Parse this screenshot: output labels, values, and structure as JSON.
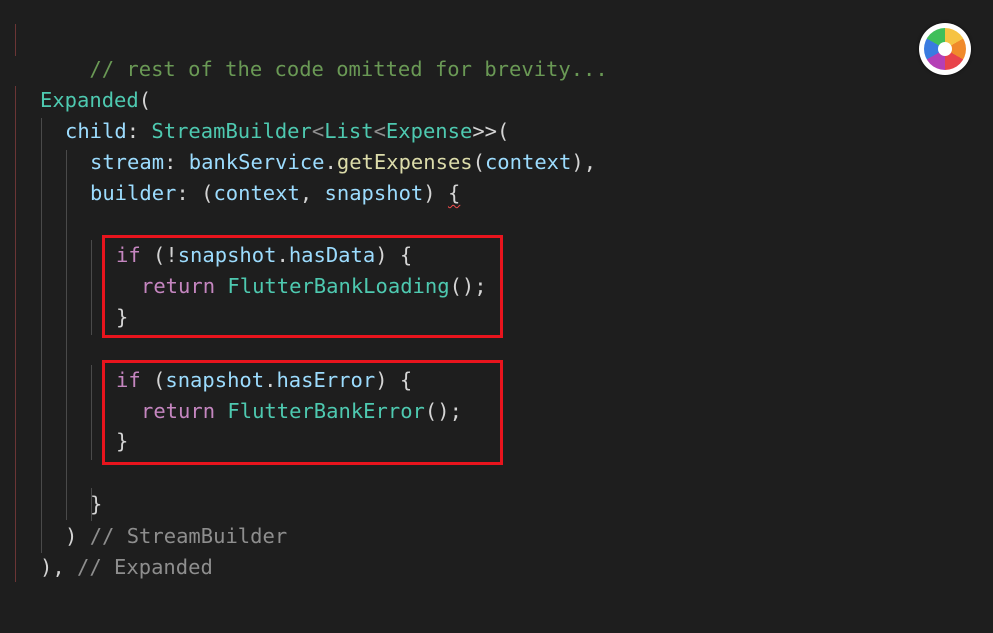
{
  "code": {
    "l1_comment": "// rest of the code omitted for brevity...",
    "l2_expanded": "Expanded",
    "l2_paren": "(",
    "l3_child": "child",
    "l3_colon": ": ",
    "l3_streambuilder": "StreamBuilder",
    "l3_lt1": "<",
    "l3_list": "List",
    "l3_lt2": "<",
    "l3_expense": "Expense",
    "l3_gt": ">>(",
    "l4_stream": "stream",
    "l4_colon": ": ",
    "l4_bankservice": "bankService",
    "l4_dot": ".",
    "l4_getexpenses": "getExpenses",
    "l4_open": "(",
    "l4_context": "context",
    "l4_close": "),",
    "l5_builder": "builder",
    "l5_colon": ": (",
    "l5_context": "context",
    "l5_comma": ", ",
    "l5_snapshot": "snapshot",
    "l5_close": ") ",
    "l5_brace": "{",
    "l6_if": "if",
    "l6_open": " (!",
    "l6_snapshot": "snapshot",
    "l6_dot": ".",
    "l6_hasdata": "hasData",
    "l6_close": ") {",
    "l7_return": "return",
    "l7_space": " ",
    "l7_loading": "FlutterBankLoading",
    "l7_end": "();",
    "l8_brace": "}",
    "l9_if": "if",
    "l9_open": " (",
    "l9_snapshot": "snapshot",
    "l9_dot": ".",
    "l9_haserror": "hasError",
    "l9_close": ") {",
    "l10_return": "return",
    "l10_space": " ",
    "l10_error": "FlutterBankError",
    "l10_end": "();",
    "l11_brace": "}",
    "l12_brace": "}",
    "l13_paren": ") ",
    "l13_comment": "// StreamBuilder",
    "l14_paren": "), ",
    "l14_comment": "// Expanded"
  },
  "colors": {
    "background": "#1e1e1e",
    "comment": "#6a9955",
    "class": "#4ec9b0",
    "property": "#9cdcfe",
    "function": "#dcdcaa",
    "keyword": "#c586c0",
    "highlight_border": "#e8141d"
  },
  "icons": {
    "app_icon": "color-wheel-icon"
  }
}
